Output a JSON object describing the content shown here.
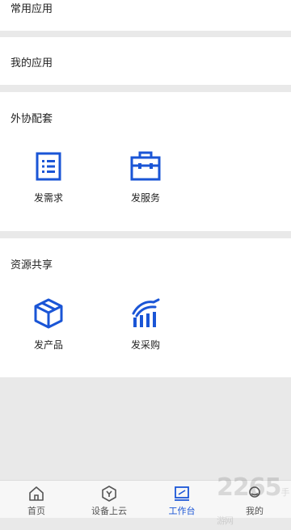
{
  "sections": {
    "common_apps": "常用应用",
    "my_apps": "我的应用",
    "outsourcing": {
      "title": "外协配套",
      "items": [
        {
          "label": "发需求",
          "icon": "list-document-icon"
        },
        {
          "label": "发服务",
          "icon": "toolbox-icon"
        }
      ]
    },
    "resource_sharing": {
      "title": "资源共享",
      "items": [
        {
          "label": "发产品",
          "icon": "box-icon"
        },
        {
          "label": "发采购",
          "icon": "purchase-chart-icon"
        }
      ]
    }
  },
  "tabbar": {
    "items": [
      {
        "label": "首页",
        "icon": "home-icon",
        "active": false
      },
      {
        "label": "设备上云",
        "icon": "device-cloud-icon",
        "active": false
      },
      {
        "label": "工作台",
        "icon": "workbench-icon",
        "active": true
      },
      {
        "label": "我的",
        "icon": "profile-icon",
        "active": false
      }
    ]
  },
  "watermark": {
    "text": "2265",
    "sub": "手游网"
  },
  "colors": {
    "accent": "#1a55d6",
    "background": "#e9e9e9"
  }
}
